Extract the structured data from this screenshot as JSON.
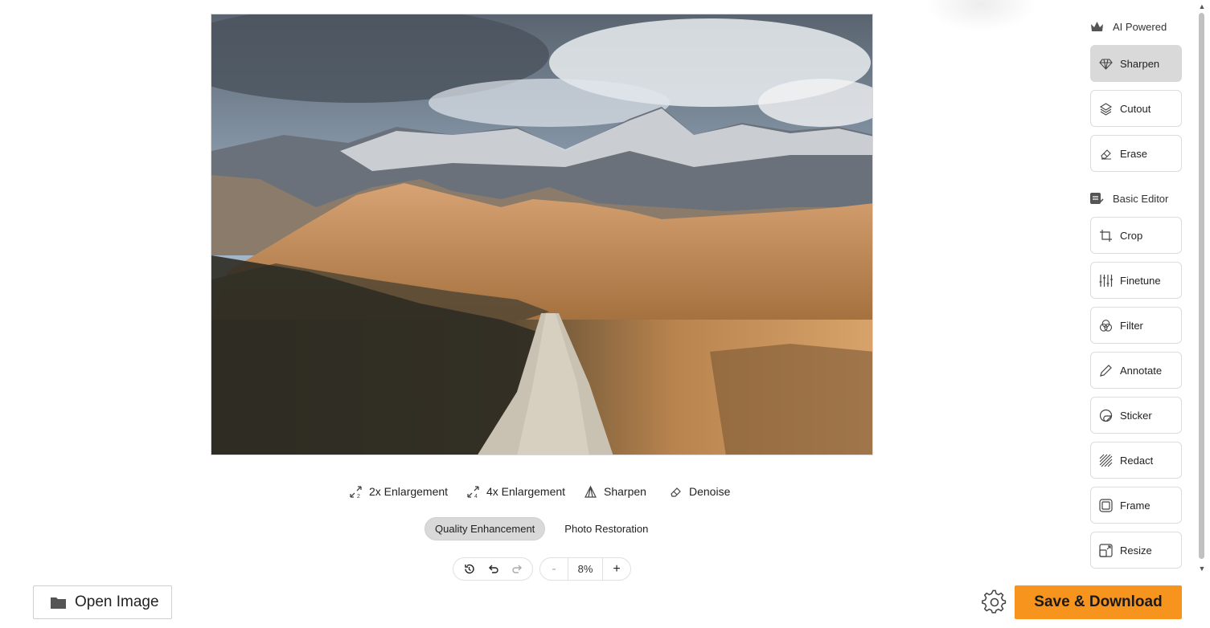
{
  "subtools": [
    {
      "label": "2x Enlargement",
      "icon": "enlarge-2x-icon"
    },
    {
      "label": "4x Enlargement",
      "icon": "enlarge-4x-icon"
    },
    {
      "label": "Sharpen",
      "icon": "sharpen-icon"
    },
    {
      "label": "Denoise",
      "icon": "denoise-icon"
    }
  ],
  "mode_tabs": [
    {
      "label": "Quality Enhancement",
      "active": true
    },
    {
      "label": "Photo Restoration",
      "active": false
    }
  ],
  "zoom": {
    "value": "8%",
    "minus": "-",
    "plus": "+"
  },
  "open_button": {
    "label": "Open Image"
  },
  "save_button": {
    "label": "Save & Download",
    "color": "#f7941d"
  },
  "sidebar": {
    "ai_section": {
      "title": "AI Powered",
      "icon": "crown-icon"
    },
    "ai_tools": [
      {
        "label": "Sharpen",
        "icon": "diamond-icon",
        "active": true
      },
      {
        "label": "Cutout",
        "icon": "layers-icon",
        "active": false
      },
      {
        "label": "Erase",
        "icon": "eraser-icon",
        "active": false
      }
    ],
    "basic_section": {
      "title": "Basic Editor",
      "icon": "editor-icon"
    },
    "basic_tools": [
      {
        "label": "Crop",
        "icon": "crop-icon"
      },
      {
        "label": "Finetune",
        "icon": "sliders-icon"
      },
      {
        "label": "Filter",
        "icon": "filter-icon"
      },
      {
        "label": "Annotate",
        "icon": "pencil-icon"
      },
      {
        "label": "Sticker",
        "icon": "sticker-icon"
      },
      {
        "label": "Redact",
        "icon": "redact-icon"
      },
      {
        "label": "Frame",
        "icon": "frame-icon"
      },
      {
        "label": "Resize",
        "icon": "resize-icon"
      }
    ]
  }
}
